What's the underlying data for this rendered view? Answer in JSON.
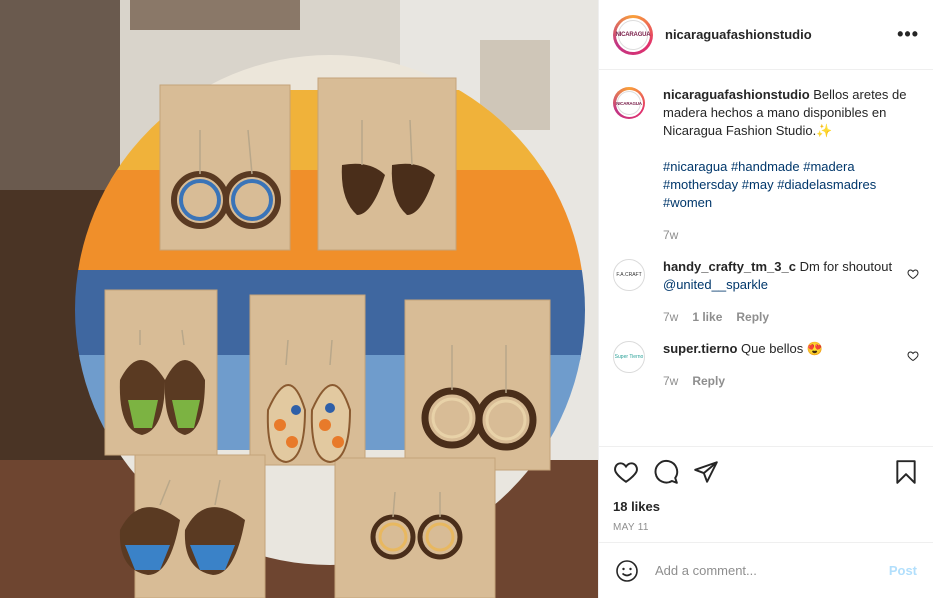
{
  "header": {
    "username": "nicaraguafashionstudio",
    "avatar_text": "NICARAGUA",
    "more_label": "•••"
  },
  "caption": {
    "username": "nicaraguafashionstudio",
    "text": "Bellos aretes de madera hechos a mano disponibles en Nicaragua Fashion Studio.",
    "emoji": "✨",
    "hashtags": [
      "#nicaragua",
      "#handmade",
      "#madera",
      "#mothersday",
      "#may",
      "#diadelasmadres",
      "#women"
    ],
    "time": "7w"
  },
  "comments": [
    {
      "username": "handy_crafty_tm_3_c",
      "text_before": "Dm for shoutout ",
      "mention": "@united__sparkle",
      "time": "7w",
      "likes": "1 like",
      "reply": "Reply",
      "avatar_text": "F.A.CRAFT"
    },
    {
      "username": "super.tierno",
      "text_before": "Que bellos ",
      "emoji": "😍",
      "time": "7w",
      "reply": "Reply",
      "avatar_text": "Super Tierno"
    }
  ],
  "actions": {
    "likes": "18 likes",
    "date": "MAY 11"
  },
  "add_comment": {
    "placeholder": "Add a comment...",
    "post_label": "Post"
  },
  "icons": [
    "heart-icon",
    "comment-icon",
    "share-icon",
    "bookmark-icon",
    "emoji-icon",
    "more-icon"
  ],
  "colors": {
    "link": "#00376b",
    "muted": "#8e8e8e",
    "post_disabled": "#b2dffc"
  }
}
